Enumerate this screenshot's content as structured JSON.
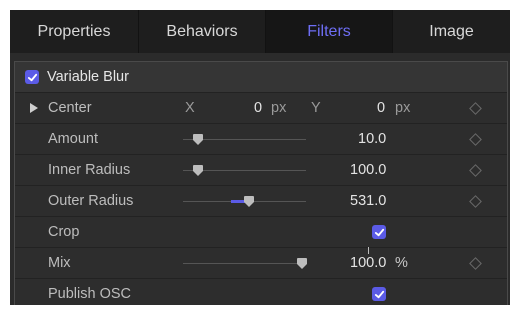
{
  "tabs": [
    {
      "label": "Properties"
    },
    {
      "label": "Behaviors"
    },
    {
      "label": "Filters"
    },
    {
      "label": "Image"
    }
  ],
  "active_tab": "Filters",
  "filter": {
    "name": "Variable Blur",
    "enabled": true
  },
  "params": {
    "center": {
      "label": "Center",
      "x_label": "X",
      "x_value": "0",
      "x_unit": "px",
      "y_label": "Y",
      "y_value": "0",
      "y_unit": "px"
    },
    "amount": {
      "label": "Amount",
      "value": "10.0",
      "slider_fraction": 0.12
    },
    "inner_radius": {
      "label": "Inner Radius",
      "value": "100.0",
      "slider_fraction": 0.12
    },
    "outer_radius": {
      "label": "Outer Radius",
      "value": "531.0",
      "slider_fraction": 0.54
    },
    "crop": {
      "label": "Crop",
      "checked": true
    },
    "mix": {
      "label": "Mix",
      "value": "100.0",
      "unit": "%",
      "slider_fraction": 0.97
    },
    "publish_osc": {
      "label": "Publish OSC",
      "checked": true
    }
  },
  "colors": {
    "accent": "#5b5be6",
    "active_tab_text": "#6e6ef4",
    "background": "#2b2b2b"
  },
  "icons": {
    "checkbox": "checkmark-icon",
    "disclosure": "disclosure-triangle-icon",
    "keyframe": "keyframe-diamond-icon",
    "thumb": "slider-thumb-icon"
  }
}
